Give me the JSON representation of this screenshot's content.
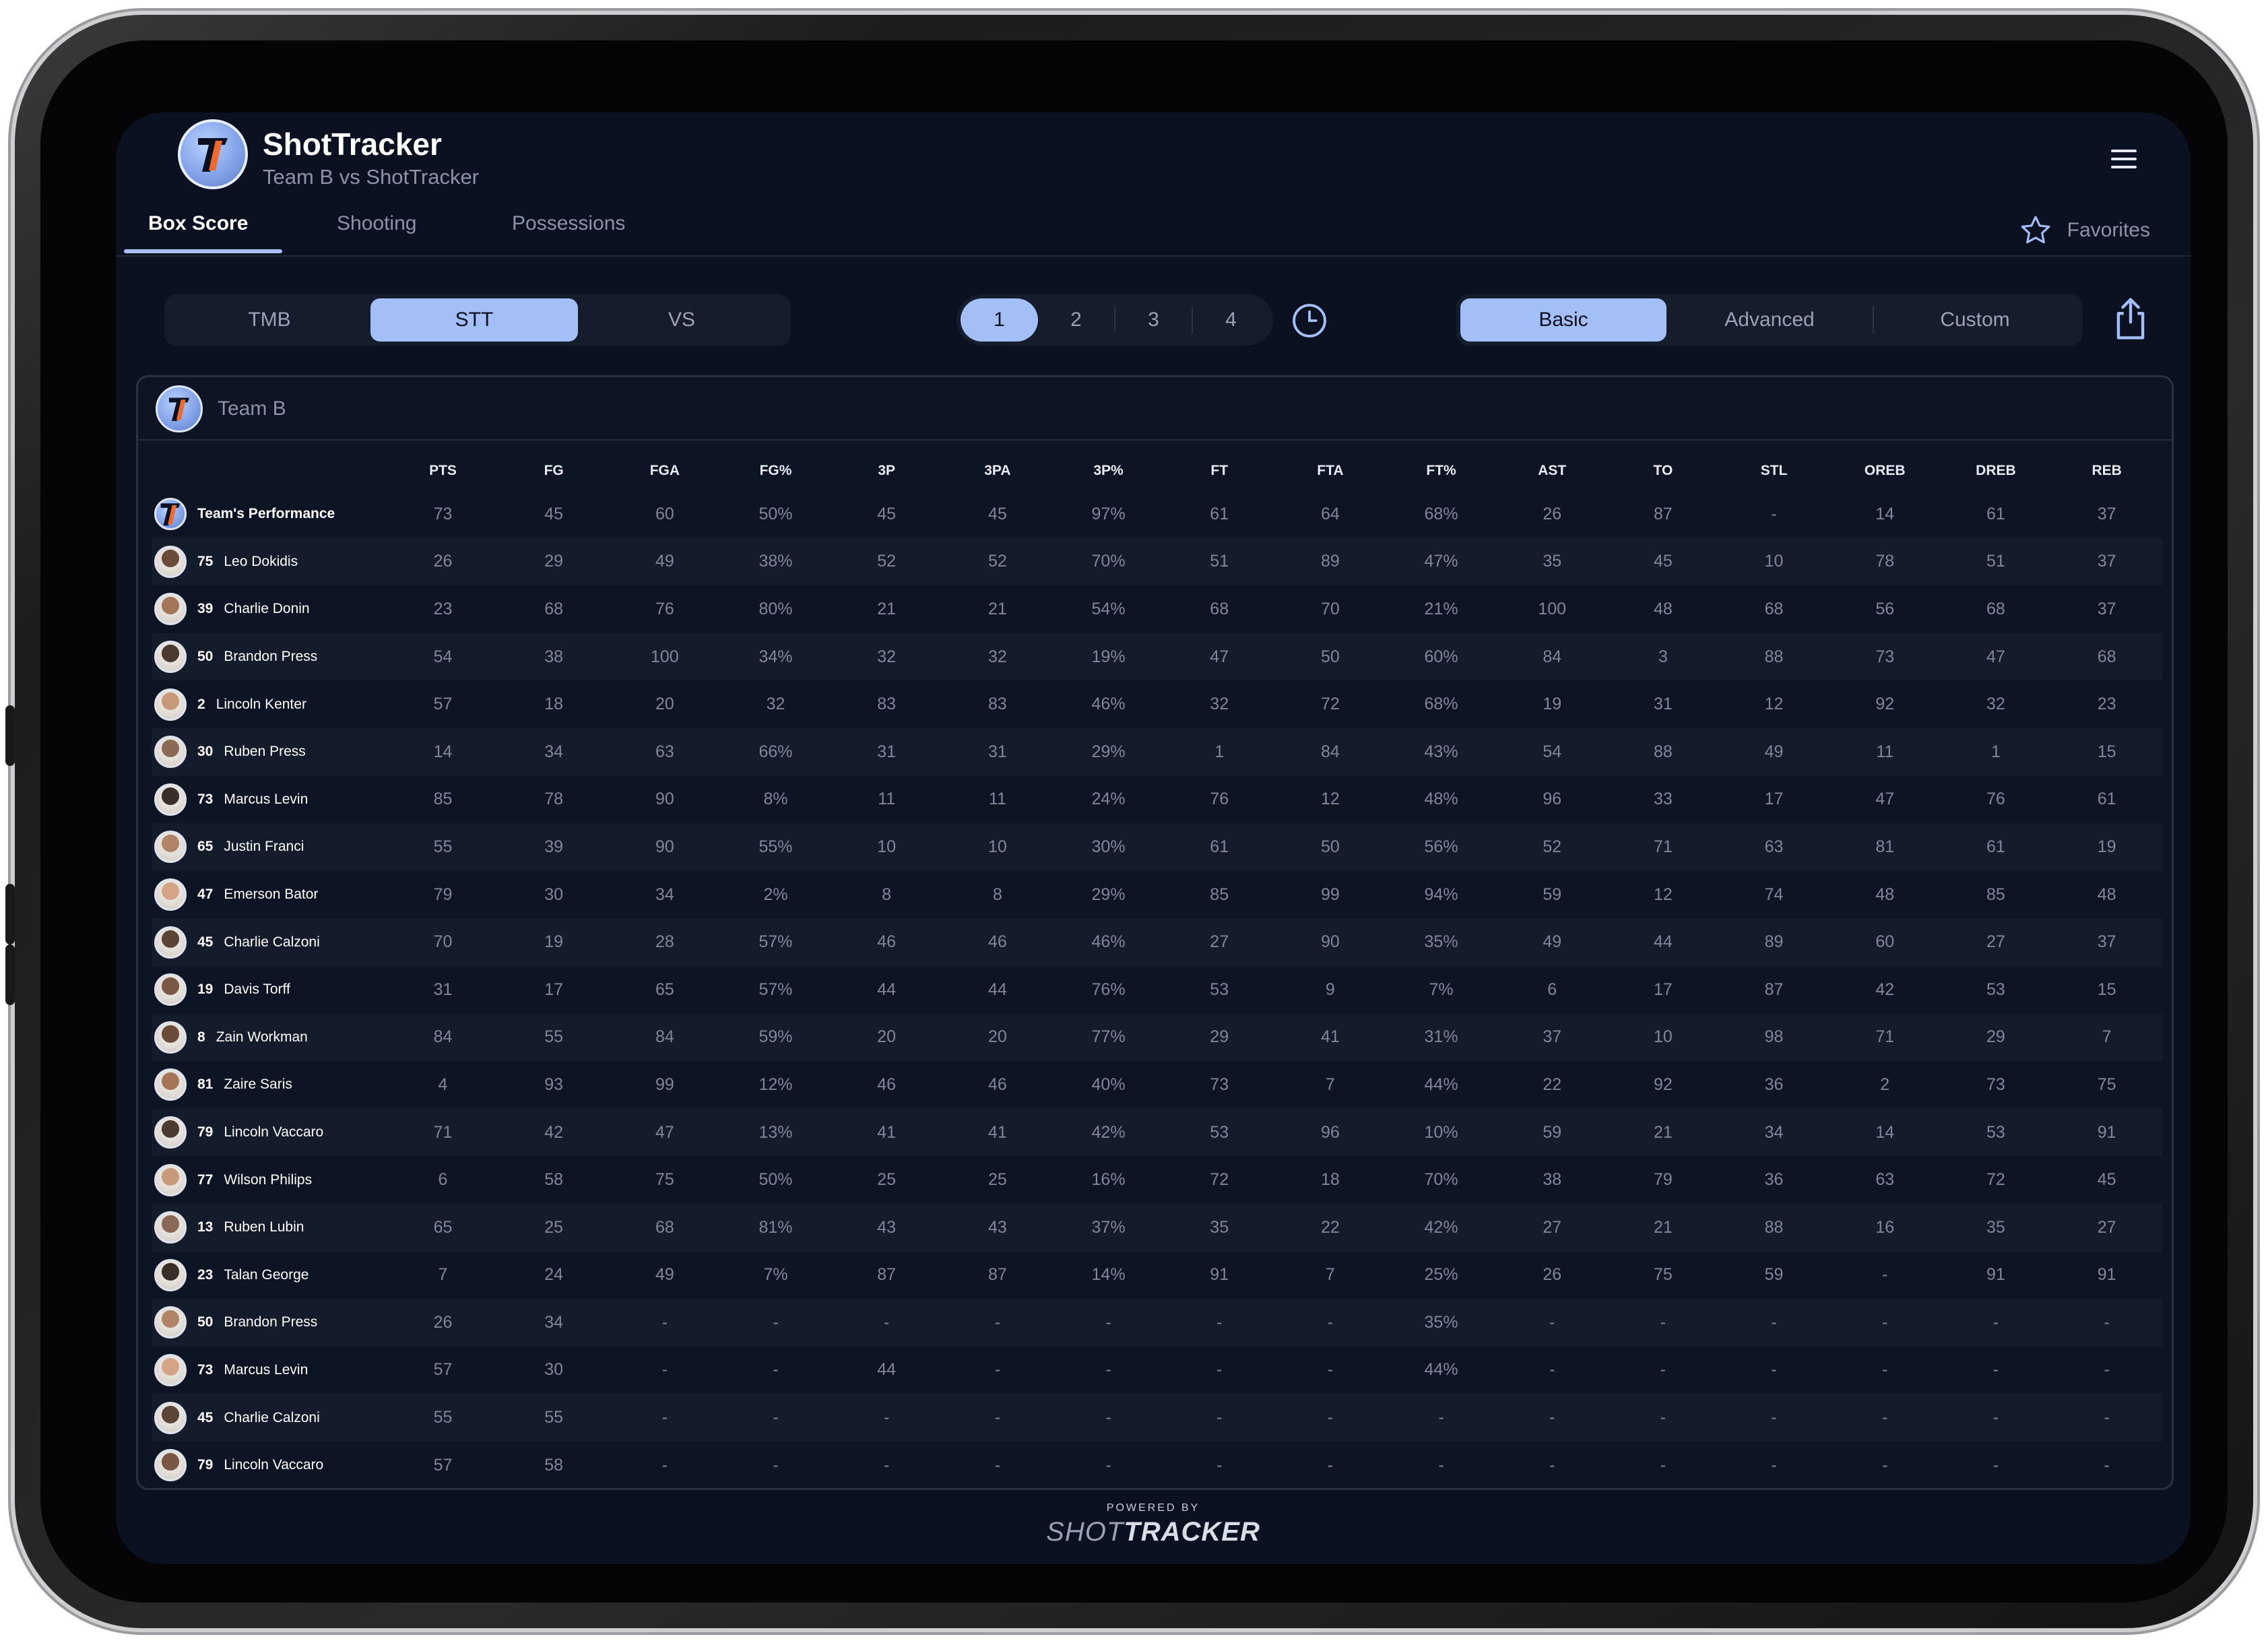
{
  "app": {
    "title": "ShotTracker",
    "subtitle": "Team B vs ShotTracker"
  },
  "tabs": [
    {
      "label": "Box Score",
      "active": true
    },
    {
      "label": "Shooting",
      "active": false
    },
    {
      "label": "Possessions",
      "active": false
    }
  ],
  "favorites_label": "Favorites",
  "team_selector": [
    {
      "label": "TMB",
      "active": false
    },
    {
      "label": "STT",
      "active": true
    },
    {
      "label": "VS",
      "active": false
    }
  ],
  "periods": [
    {
      "label": "1",
      "active": true
    },
    {
      "label": "2",
      "active": false
    },
    {
      "label": "3",
      "active": false
    },
    {
      "label": "4",
      "active": false
    }
  ],
  "view_modes": [
    {
      "label": "Basic",
      "active": true
    },
    {
      "label": "Advanced",
      "active": false
    },
    {
      "label": "Custom",
      "active": false
    }
  ],
  "team_name": "Team B",
  "columns": [
    "PTS",
    "FG",
    "FGA",
    "FG%",
    "3P",
    "3PA",
    "3P%",
    "FT",
    "FTA",
    "FT%",
    "AST",
    "TO",
    "STL",
    "OREB",
    "DREB",
    "REB"
  ],
  "team_row": {
    "label": "Team's Performance",
    "stats": [
      "73",
      "45",
      "60",
      "50%",
      "45",
      "45",
      "97%",
      "61",
      "64",
      "68%",
      "26",
      "87",
      "-",
      "14",
      "61",
      "37"
    ]
  },
  "players": [
    {
      "number": "75",
      "name": "Leo Dokidis",
      "stats": [
        "26",
        "29",
        "49",
        "38%",
        "52",
        "52",
        "70%",
        "51",
        "89",
        "47%",
        "35",
        "45",
        "10",
        "78",
        "51",
        "37"
      ]
    },
    {
      "number": "39",
      "name": "Charlie Donin",
      "stats": [
        "23",
        "68",
        "76",
        "80%",
        "21",
        "21",
        "54%",
        "68",
        "70",
        "21%",
        "100",
        "48",
        "68",
        "56",
        "68",
        "37"
      ]
    },
    {
      "number": "50",
      "name": "Brandon Press",
      "stats": [
        "54",
        "38",
        "100",
        "34%",
        "32",
        "32",
        "19%",
        "47",
        "50",
        "60%",
        "84",
        "3",
        "88",
        "73",
        "47",
        "68"
      ]
    },
    {
      "number": "2",
      "name": "Lincoln Kenter",
      "stats": [
        "57",
        "18",
        "20",
        "32",
        "83",
        "83",
        "46%",
        "32",
        "72",
        "68%",
        "19",
        "31",
        "12",
        "92",
        "32",
        "23"
      ]
    },
    {
      "number": "30",
      "name": "Ruben Press",
      "stats": [
        "14",
        "34",
        "63",
        "66%",
        "31",
        "31",
        "29%",
        "1",
        "84",
        "43%",
        "54",
        "88",
        "49",
        "11",
        "1",
        "15"
      ]
    },
    {
      "number": "73",
      "name": "Marcus Levin",
      "stats": [
        "85",
        "78",
        "90",
        "8%",
        "11",
        "11",
        "24%",
        "76",
        "12",
        "48%",
        "96",
        "33",
        "17",
        "47",
        "76",
        "61"
      ]
    },
    {
      "number": "65",
      "name": "Justin Franci",
      "stats": [
        "55",
        "39",
        "90",
        "55%",
        "10",
        "10",
        "30%",
        "61",
        "50",
        "56%",
        "52",
        "71",
        "63",
        "81",
        "61",
        "19"
      ]
    },
    {
      "number": "47",
      "name": "Emerson Bator",
      "stats": [
        "79",
        "30",
        "34",
        "2%",
        "8",
        "8",
        "29%",
        "85",
        "99",
        "94%",
        "59",
        "12",
        "74",
        "48",
        "85",
        "48"
      ]
    },
    {
      "number": "45",
      "name": "Charlie Calzoni",
      "stats": [
        "70",
        "19",
        "28",
        "57%",
        "46",
        "46",
        "46%",
        "27",
        "90",
        "35%",
        "49",
        "44",
        "89",
        "60",
        "27",
        "37"
      ]
    },
    {
      "number": "19",
      "name": "Davis Torff",
      "stats": [
        "31",
        "17",
        "65",
        "57%",
        "44",
        "44",
        "76%",
        "53",
        "9",
        "7%",
        "6",
        "17",
        "87",
        "42",
        "53",
        "15"
      ]
    },
    {
      "number": "8",
      "name": "Zain Workman",
      "stats": [
        "84",
        "55",
        "84",
        "59%",
        "20",
        "20",
        "77%",
        "29",
        "41",
        "31%",
        "37",
        "10",
        "98",
        "71",
        "29",
        "7"
      ]
    },
    {
      "number": "81",
      "name": "Zaire Saris",
      "stats": [
        "4",
        "93",
        "99",
        "12%",
        "46",
        "46",
        "40%",
        "73",
        "7",
        "44%",
        "22",
        "92",
        "36",
        "2",
        "73",
        "75"
      ]
    },
    {
      "number": "79",
      "name": "Lincoln Vaccaro",
      "stats": [
        "71",
        "42",
        "47",
        "13%",
        "41",
        "41",
        "42%",
        "53",
        "96",
        "10%",
        "59",
        "21",
        "34",
        "14",
        "53",
        "91"
      ]
    },
    {
      "number": "77",
      "name": "Wilson Philips",
      "stats": [
        "6",
        "58",
        "75",
        "50%",
        "25",
        "25",
        "16%",
        "72",
        "18",
        "70%",
        "38",
        "79",
        "36",
        "63",
        "72",
        "45"
      ]
    },
    {
      "number": "13",
      "name": "Ruben Lubin",
      "stats": [
        "65",
        "25",
        "68",
        "81%",
        "43",
        "43",
        "37%",
        "35",
        "22",
        "42%",
        "27",
        "21",
        "88",
        "16",
        "35",
        "27"
      ]
    },
    {
      "number": "23",
      "name": "Talan George",
      "stats": [
        "7",
        "24",
        "49",
        "7%",
        "87",
        "87",
        "14%",
        "91",
        "7",
        "25%",
        "26",
        "75",
        "59",
        "-",
        "91",
        "91"
      ]
    },
    {
      "number": "50",
      "name": "Brandon Press",
      "stats": [
        "26",
        "34",
        "-",
        "-",
        "-",
        "-",
        "-",
        "-",
        "-",
        "35%",
        "-",
        "-",
        "-",
        "-",
        "-",
        "-"
      ]
    },
    {
      "number": "73",
      "name": "Marcus Levin",
      "stats": [
        "57",
        "30",
        "-",
        "-",
        "44",
        "-",
        "-",
        "-",
        "-",
        "44%",
        "-",
        "-",
        "-",
        "-",
        "-",
        "-"
      ]
    },
    {
      "number": "45",
      "name": "Charlie Calzoni",
      "stats": [
        "55",
        "55",
        "-",
        "-",
        "-",
        "-",
        "-",
        "-",
        "-",
        "-",
        "-",
        "-",
        "-",
        "-",
        "-",
        "-"
      ]
    },
    {
      "number": "79",
      "name": "Lincoln Vaccaro",
      "stats": [
        "57",
        "58",
        "-",
        "-",
        "-",
        "-",
        "-",
        "-",
        "-",
        "-",
        "-",
        "-",
        "-",
        "-",
        "-",
        "-"
      ]
    }
  ],
  "footer": {
    "powered_by": "POWERED BY",
    "brand_a": "SHOT",
    "brand_b": "TRACKER"
  },
  "colors": {
    "background": "#0b1120",
    "accent": "#a3bff5",
    "logo_orange": "#ef6a2e"
  },
  "icons": [
    "menu-icon",
    "star-icon",
    "clock-icon",
    "share-icon"
  ]
}
